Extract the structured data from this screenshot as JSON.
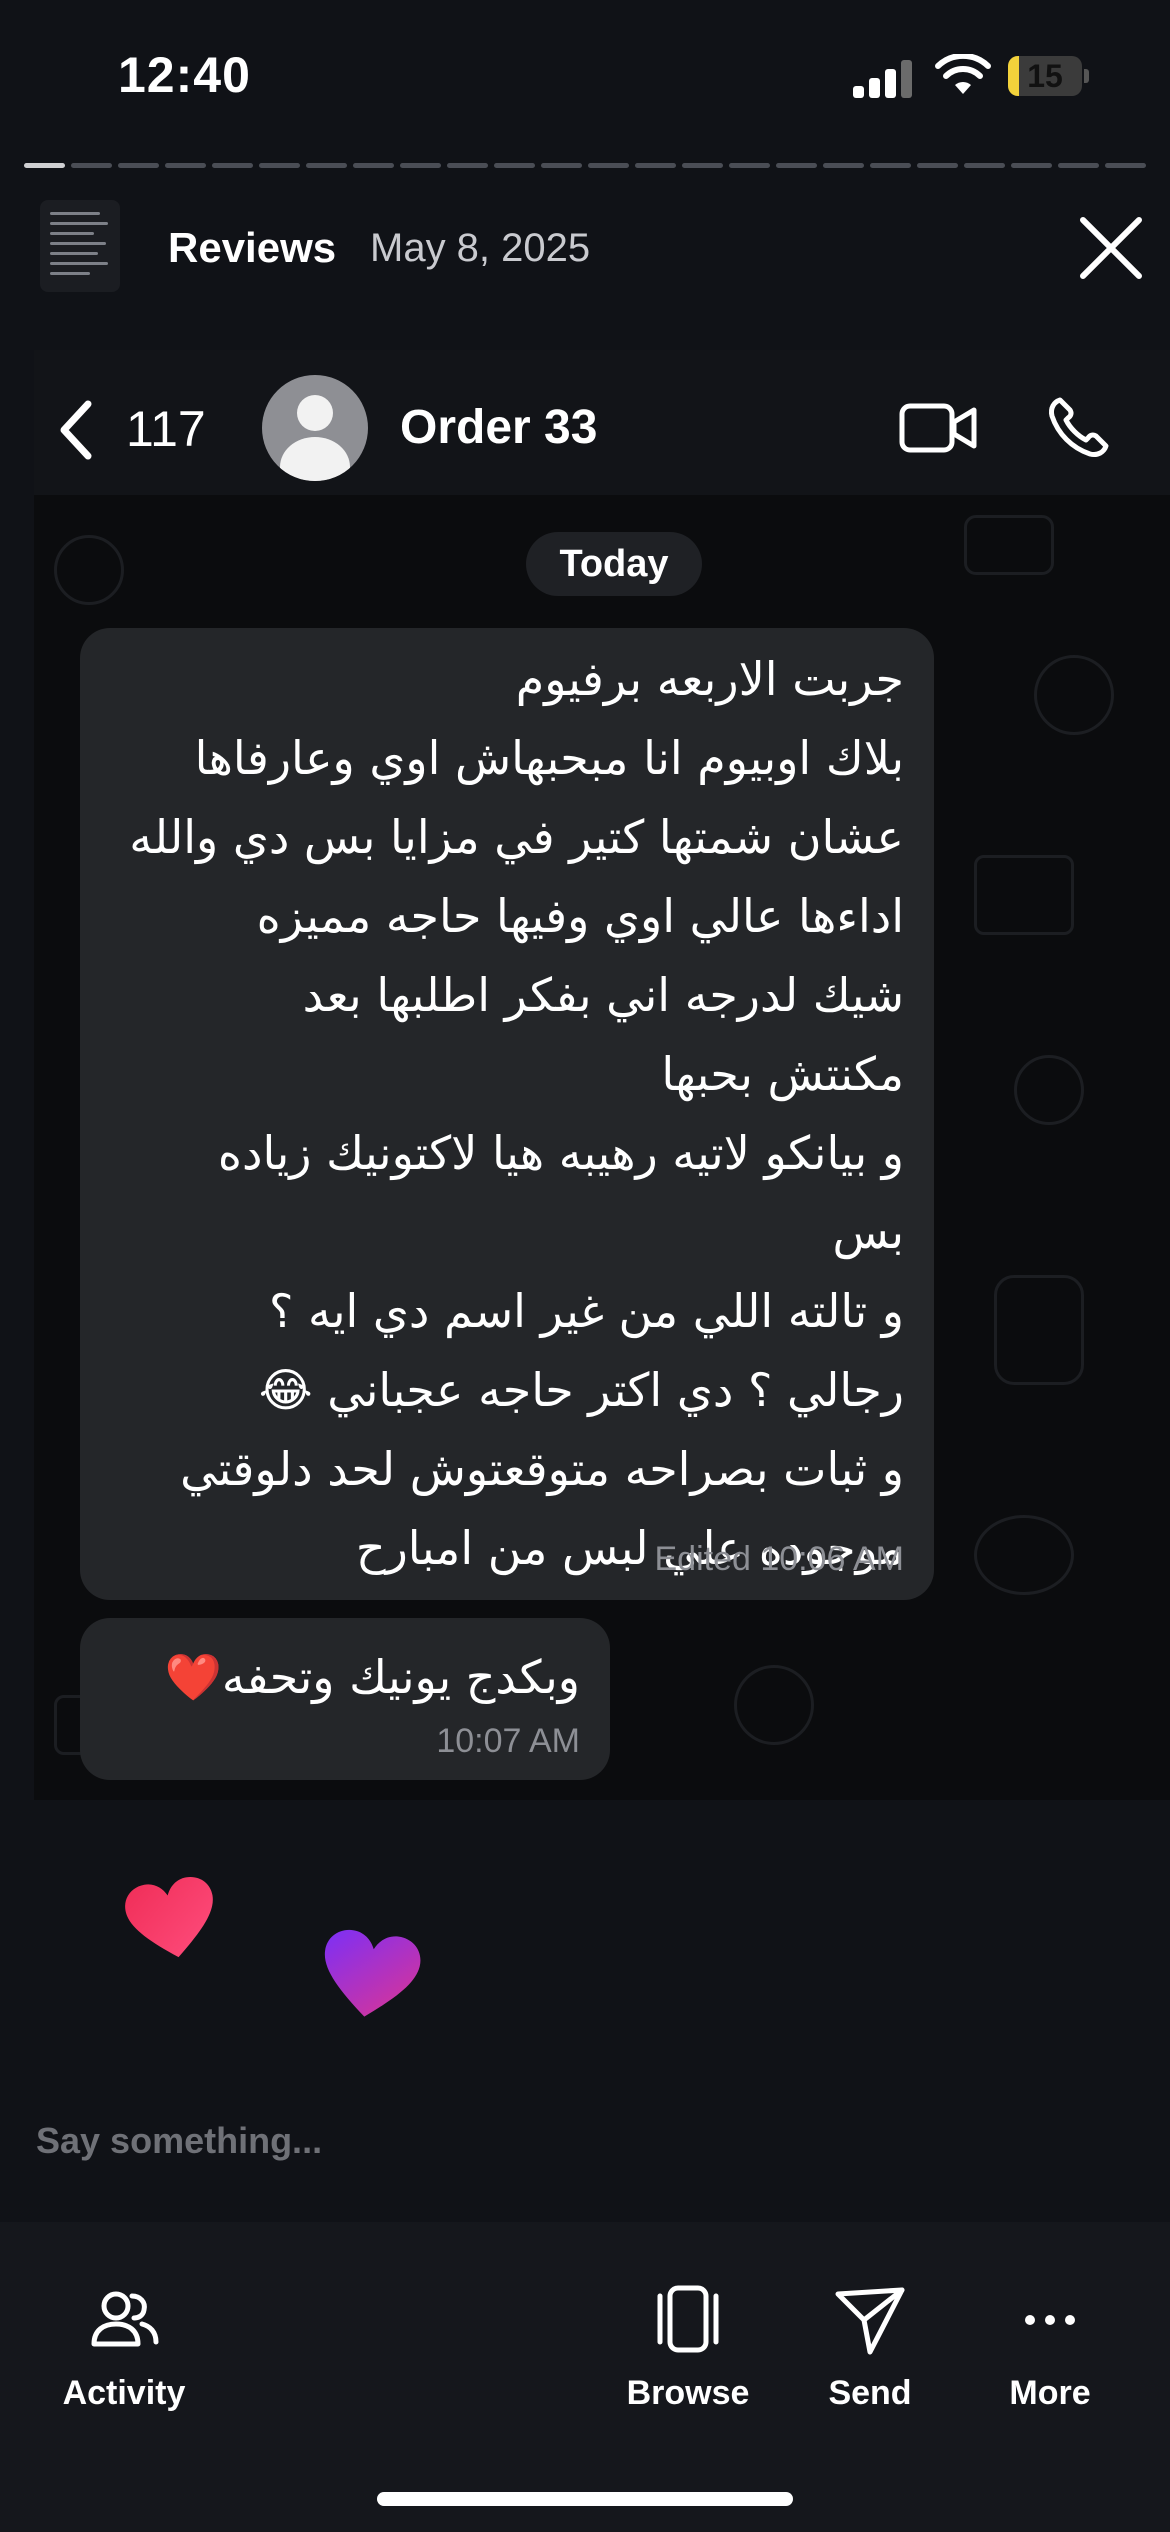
{
  "status_bar": {
    "time": "12:40",
    "battery": "15",
    "battery_level": 0.15
  },
  "story": {
    "name": "Reviews",
    "date": "May 8, 2025",
    "segments_total": 24,
    "segments_done": 1
  },
  "chat": {
    "back_count": "117",
    "title": "Order 33",
    "day_label": "Today",
    "messages": [
      {
        "lines": [
          "جربت الاربعه برفيوم",
          "بلاك اوبيوم انا مبحبهاش اوي وعارفاها",
          "عشان شمتها كتير في مزايا بس دي والله",
          "اداءها عالي اوي وفيها حاجه مميزه",
          "شيك لدرجه اني بفكر اطلبها بعد",
          "مكنتش بحبها",
          "و بيانكو لاتيه رهيبه هيا لاكتونيك زياده",
          "بس",
          "و تالته اللي من غير اسم دي ايه ؟",
          "رجالي ؟ دي اكتر حاجه عجباني 😂",
          "و ثبات بصراحه متوقعتوش لحد دلوقتي",
          "موجوده علي لبس من امبارح"
        ],
        "edited_label": "Edited",
        "time": "10:06 AM"
      },
      {
        "lines": [
          "وبكدج يونيك وتحفه❤️"
        ],
        "time": "10:07 AM"
      }
    ]
  },
  "reactions": [
    {
      "icon": "heart-icon",
      "color_start": "#f02e58",
      "color_end": "#ff4e7e"
    },
    {
      "icon": "heart-icon",
      "color_start": "#7b2ff7",
      "color_end": "#e0358f"
    }
  ],
  "comment": {
    "placeholder": "Say something..."
  },
  "bottom_nav": {
    "activity": "Activity",
    "browse": "Browse",
    "send": "Send",
    "more": "More"
  }
}
